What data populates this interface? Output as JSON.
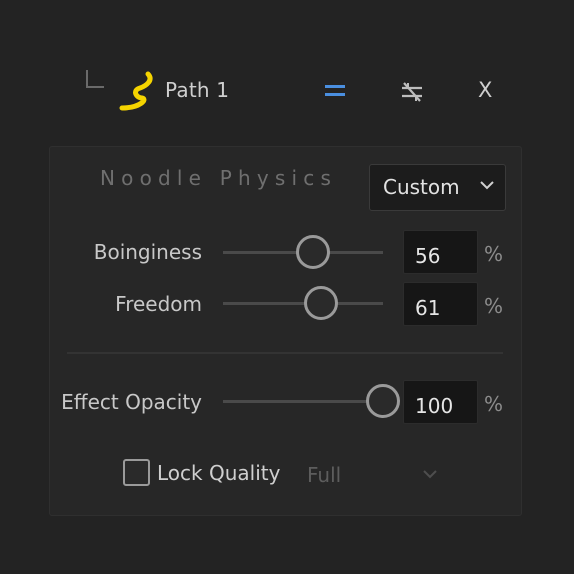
{
  "header": {
    "path_name": "Path 1",
    "close_label": "X",
    "icons": {
      "tree": "tree-corner-icon",
      "path": "squiggle-path-icon",
      "equal": "equals-icon",
      "unlink": "unlink-icon"
    },
    "colors": {
      "path_icon": "#f5d400",
      "equal_icon": "#4a8fe0"
    }
  },
  "panel": {
    "title": "Noodle Physics",
    "preset": {
      "value": "Custom"
    },
    "sliders": [
      {
        "label": "Boinginess",
        "value": "56",
        "unit": "%",
        "fraction": 0.56
      },
      {
        "label": "Freedom",
        "value": "61",
        "unit": "%",
        "fraction": 0.61
      },
      {
        "label": "Effect Opacity",
        "value": "100",
        "unit": "%",
        "fraction": 1.0
      }
    ],
    "lock_quality": {
      "label": "Lock Quality",
      "checked": false,
      "quality_value": "Full"
    }
  }
}
